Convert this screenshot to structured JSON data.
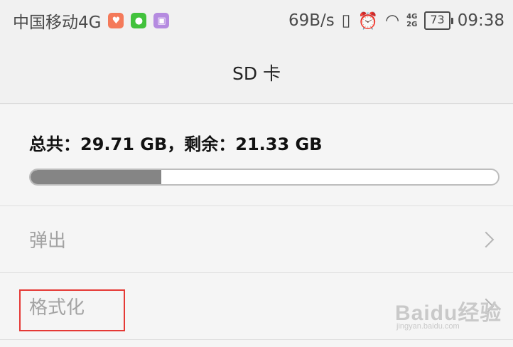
{
  "status_bar": {
    "carrier": "中国移动4G",
    "speed": "69B/s",
    "signal_top": "4G",
    "signal_bottom": "2G",
    "battery": "73",
    "time": "09:38",
    "icons": [
      "health-app-icon",
      "wechat-icon",
      "gallery-icon",
      "vibrate-icon",
      "alarm-icon",
      "wifi-icon",
      "signal-icon",
      "battery-icon"
    ]
  },
  "header": {
    "title": "SD 卡"
  },
  "storage": {
    "summary": "总共：29.71 GB，剩余：21.33 GB",
    "used_fraction": 0.28,
    "bar_color": "#858585"
  },
  "menu": {
    "eject_label": "弹出",
    "format_label": "格式化"
  },
  "watermark": {
    "brand": "Baidu经验",
    "url": "jingyan.baidu.com"
  }
}
